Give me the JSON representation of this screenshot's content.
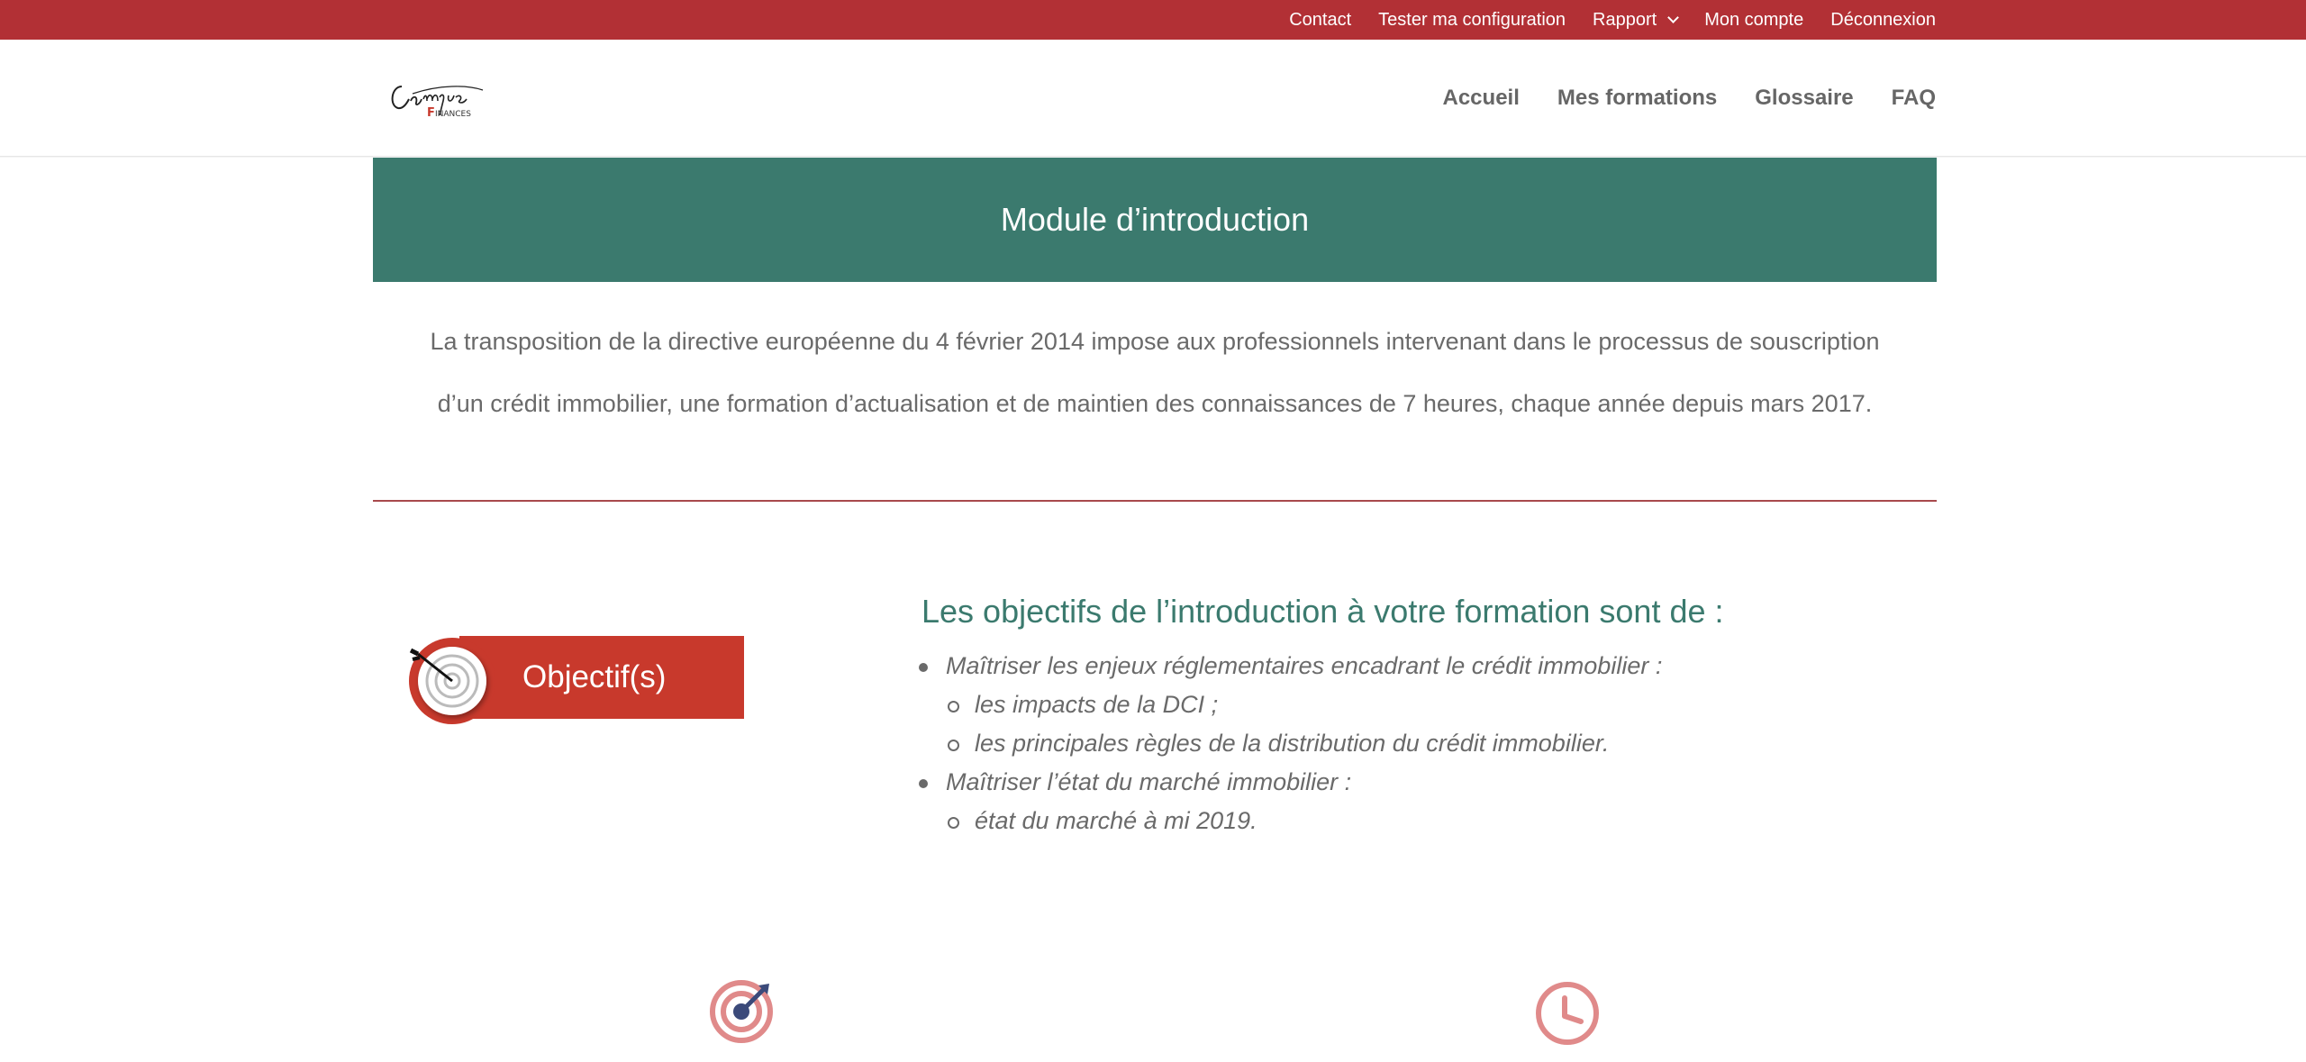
{
  "topbar": {
    "items": [
      {
        "label": "Contact"
      },
      {
        "label": "Tester ma configuration"
      },
      {
        "label": "Rapport"
      },
      {
        "label": "Mon compte"
      },
      {
        "label": "Déconnexion"
      }
    ],
    "background": "#b23035"
  },
  "header": {
    "logo": {
      "text": "Campus",
      "subtext": "FINANCES",
      "icon": "campus-finances-logo"
    },
    "nav": [
      {
        "label": "Accueil"
      },
      {
        "label": "Mes formations"
      },
      {
        "label": "Glossaire"
      },
      {
        "label": "FAQ"
      }
    ]
  },
  "banner": {
    "title": "Module d’introduction",
    "color": "#3b7a6e"
  },
  "intro": {
    "line1": "La transposition de la directive européenne du 4 février 2014 impose aux professionnels intervenant dans le processus de souscription",
    "line2": "d’un crédit immobilier, une formation d’actualisation et de maintien des connaissances de 7 heures, chaque année depuis mars 2017."
  },
  "objectives": {
    "badge_label": "Objectif(s)",
    "badge_icon": "target-icon",
    "title": "Les objectifs de l’introduction à votre formation sont de :",
    "items": [
      {
        "text": "Maîtriser les enjeux réglementaires encadrant le crédit immobilier :"
      },
      {
        "text": "les impacts de la DCI ;"
      },
      {
        "text": "les principales règles de la distribution du crédit immobilier."
      },
      {
        "text": "Maîtriser l’état du marché immobilier :"
      },
      {
        "text": "état du marché à mi 2019."
      }
    ]
  },
  "bottom_icons": [
    {
      "icon": "target-icon"
    },
    {
      "icon": "clock-icon"
    }
  ],
  "colors": {
    "accent_red": "#b23035",
    "accent_green": "#3b7a6e",
    "badge_red": "#c8392c"
  }
}
